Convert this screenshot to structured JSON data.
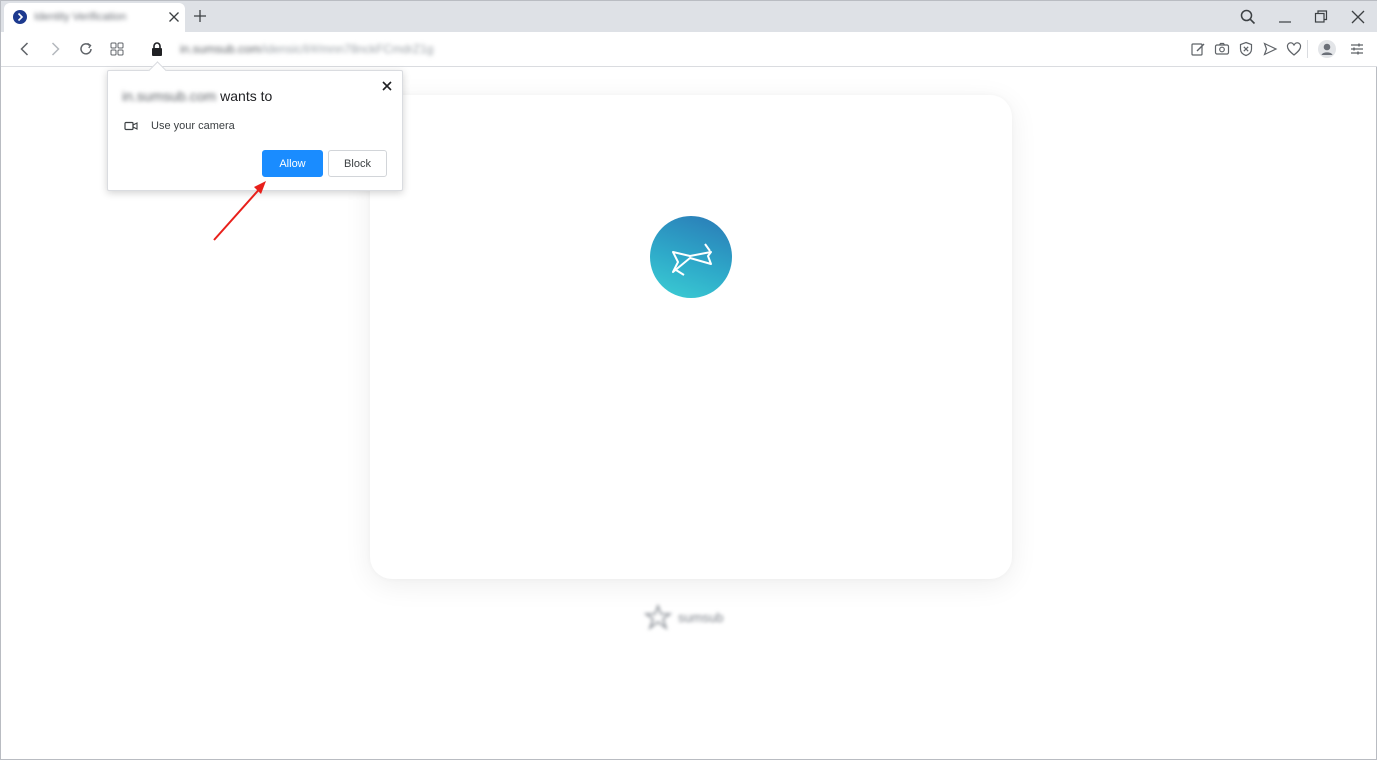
{
  "tab": {
    "title": "Identity Verification",
    "favicon": "sumsub-chevron-icon"
  },
  "toolbar": {
    "url_host": "in.sumsub.com",
    "url_path": "/idensic/l/#/mnn78nckFCmdrZ1g"
  },
  "permission_prompt": {
    "origin": "in.sumsub.com",
    "title_suffix": "wants to",
    "permission_label": "Use your camera",
    "permission_icon": "video-camera-icon",
    "allow_label": "Allow",
    "block_label": "Block"
  },
  "page": {
    "brand_name": "sumsub",
    "loader_icon": "sumsub-hourglass-icon"
  },
  "colors": {
    "allow_button": "#1a8cff",
    "annotation_arrow": "#e8201b",
    "logo_gradient_start": "#2a79b6",
    "logo_gradient_end": "#3ccfd4"
  }
}
